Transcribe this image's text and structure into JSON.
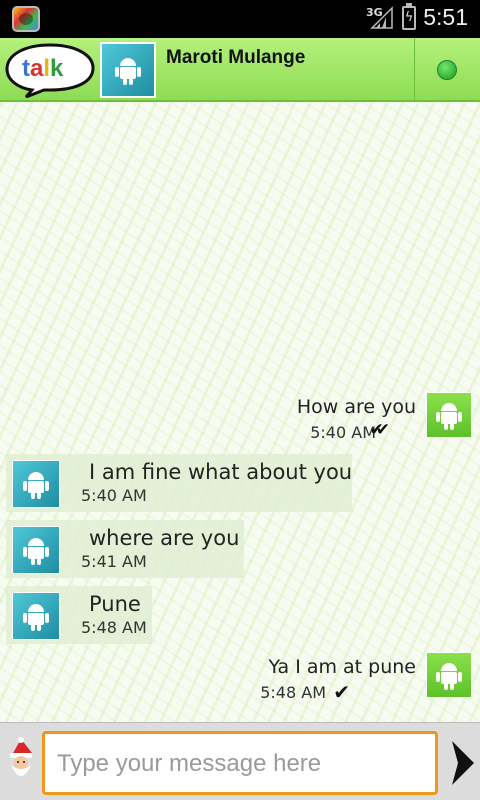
{
  "status_bar": {
    "network": "3G",
    "time": "5:51"
  },
  "header": {
    "contact_name": "Maroti Mulange",
    "logo_text": "talk"
  },
  "messages": [
    {
      "direction": "out",
      "text": "How are you",
      "time": "5:40 AM",
      "tick": "✔✔"
    },
    {
      "direction": "in",
      "text": "I am fine what about you",
      "time": "5:40 AM"
    },
    {
      "direction": "in",
      "text": "where are you",
      "time": "5:41 AM"
    },
    {
      "direction": "in",
      "text": "Pune",
      "time": "5:48 AM"
    },
    {
      "direction": "out",
      "text": "Ya I am at pune",
      "time": "5:48 AM",
      "tick": "✔"
    }
  ],
  "composer": {
    "placeholder": "Type your message here",
    "value": ""
  },
  "colors": {
    "header_green": "#8ddc55",
    "status_online": "#1a9a1a",
    "input_border": "#f0961e"
  }
}
